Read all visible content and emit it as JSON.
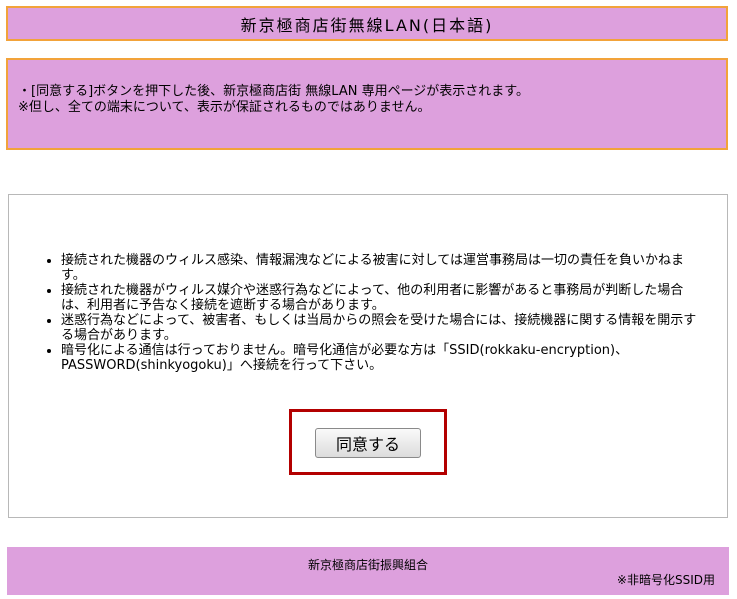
{
  "header": {
    "title": "新京極商店街無線LAN(日本語)"
  },
  "notice": {
    "line1": "・[同意する]ボタンを押下した後、新京極商店街 無線LAN 専用ページが表示されます。",
    "line2": "※但し、全ての端末について、表示が保証されるものではありません。"
  },
  "terms": {
    "items": [
      "接続された機器のウィルス感染、情報漏洩などによる被害に対しては運営事務局は一切の責任を負いかねます。",
      "接続された機器がウィルス媒介や迷惑行為などによって、他の利用者に影響があると事務局が判断した場合は、利用者に予告なく接続を遮断する場合があります。",
      "迷惑行為などによって、被害者、もしくは当局からの照会を受けた場合には、接続機器に関する情報を開示する場合があります。",
      "暗号化による通信は行っておりません。暗号化通信が必要な方は「SSID(rokkaku-encryption)、PASSWORD(shinkyogoku)」へ接続を行って下さい。"
    ]
  },
  "agree": {
    "label": "同意する"
  },
  "footer": {
    "org": "新京極商店街振興組合",
    "note": "※非暗号化SSID用"
  }
}
